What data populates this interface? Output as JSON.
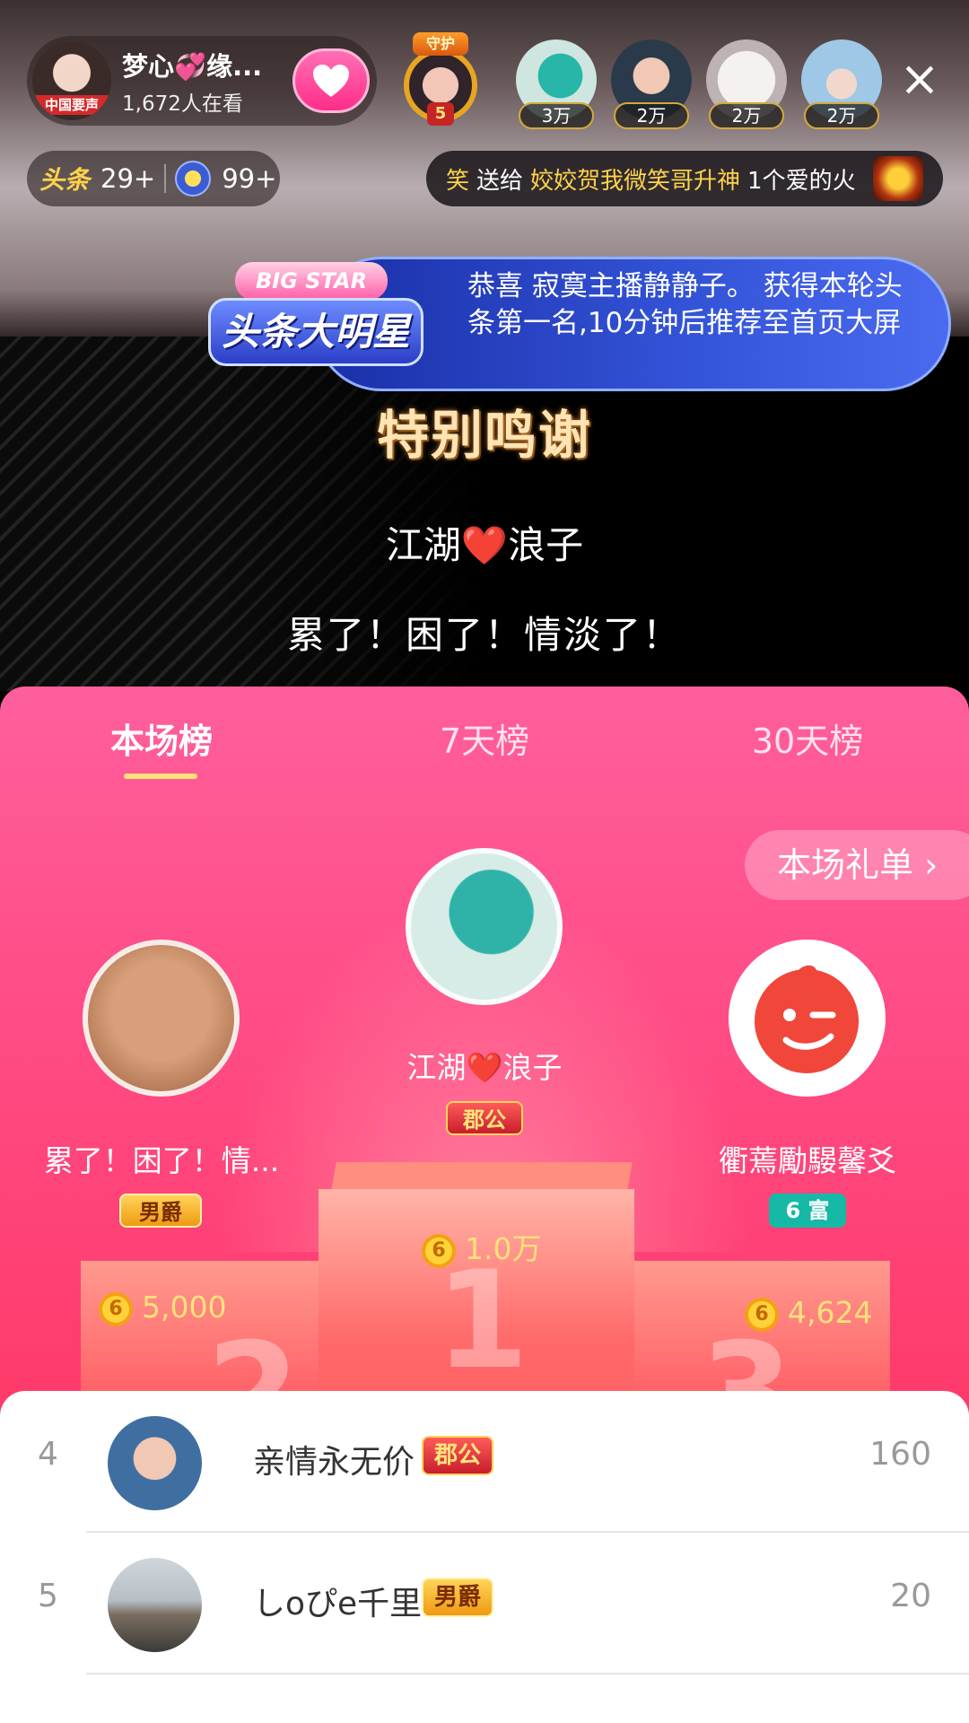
{
  "host": {
    "name": "梦心💞缘...",
    "viewers": "1,672人在看",
    "avatar_tag": "中国要声"
  },
  "guard_badge": {
    "label": "守护",
    "count": "5"
  },
  "top_viewers": [
    {
      "amount": "3万"
    },
    {
      "amount": "2万"
    },
    {
      "amount": "2万"
    },
    {
      "amount": "2万"
    }
  ],
  "stats": {
    "toutiao_label": "头条",
    "toutiao_rank": "29+",
    "star_rank": "99+"
  },
  "ticker": {
    "head": "笑",
    "verb": "送给",
    "recipient": "姣姣贺我微笑哥升神",
    "gift": "1个爱的火"
  },
  "bigstar": {
    "cap": "BIG STAR",
    "title": "头条大明星",
    "message": "恭喜 寂寞主播静静子。 获得本轮头条第一名,10分钟后推荐至首页大屏"
  },
  "thanks": {
    "title": "特别鸣谢",
    "line1": "江湖❤️浪子",
    "line2": "累了！困了！情淡了！"
  },
  "leaderboard": {
    "tabs": [
      {
        "label": "本场榜"
      },
      {
        "label": "7天榜"
      },
      {
        "label": "30天榜"
      }
    ],
    "gift_list_button": "本场礼单 ›",
    "first": {
      "name": "江湖❤️浪子",
      "badge": "郡公",
      "score": "1.0万",
      "rank": "1"
    },
    "second": {
      "name": "累了！困了！情...",
      "badge": "男爵",
      "score": "5,000",
      "rank": "2"
    },
    "third": {
      "name": "衢蔫勵騴馨爻",
      "badge": "6 富",
      "score": "4,624",
      "rank": "3"
    },
    "rows": [
      {
        "rank": "4",
        "name": "亲情永无价",
        "badge": "郡公",
        "value": "160"
      },
      {
        "rank": "5",
        "name": "しoぴe千里",
        "badge": "男爵",
        "value": "20"
      }
    ]
  },
  "colors": {
    "accent_pink": "#ff4a83",
    "gold": "#ffe27a",
    "teal": "#16b8a6"
  }
}
